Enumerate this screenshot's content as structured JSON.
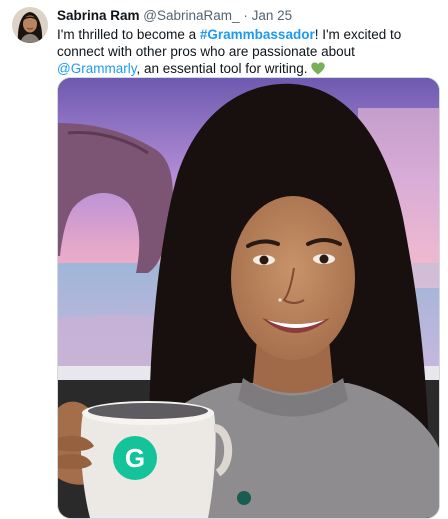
{
  "tweet": {
    "author_name": "Sabrina Ram",
    "author_handle": "@SabrinaRam_",
    "separator": "·",
    "date": "Jan 25",
    "text_part1": "I'm thrilled to become a ",
    "hashtag": "#Grammbassador",
    "text_part2": "! I'm excited to connect with other pros who are passionate about ",
    "mention": "@Grammarly",
    "text_part3": ", an essential tool for writing. ",
    "emoji_icon": "green-heart-icon"
  },
  "media": {
    "description_icon": "photo",
    "mug_logo_letter": "G"
  },
  "colors": {
    "link": "#1d9bf0",
    "secondary_text": "#536471",
    "grammarly_green": "#15c39a",
    "heart_green": "#78b159"
  }
}
